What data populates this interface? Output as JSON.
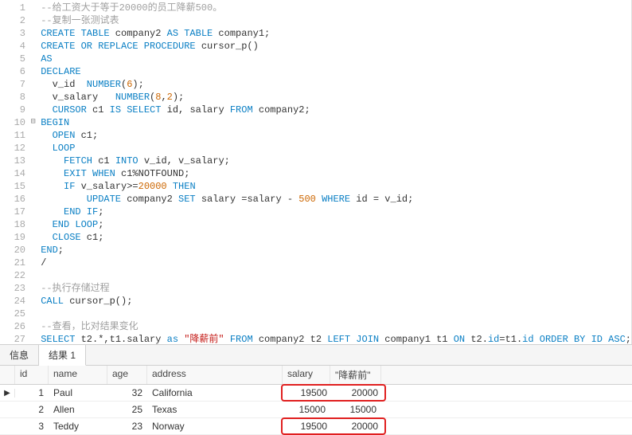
{
  "code": {
    "lines": [
      {
        "n": 1,
        "segs": [
          {
            "c": "cm",
            "t": "--给工资大于等于20000的员工降薪500。"
          }
        ]
      },
      {
        "n": 2,
        "segs": [
          {
            "c": "cm",
            "t": "--复制一张测试表"
          }
        ]
      },
      {
        "n": 3,
        "segs": [
          {
            "c": "kw",
            "t": "CREATE TABLE"
          },
          {
            "c": "fn",
            "t": " company2 "
          },
          {
            "c": "kw",
            "t": "AS TABLE"
          },
          {
            "c": "fn",
            "t": " company1;"
          }
        ]
      },
      {
        "n": 4,
        "segs": [
          {
            "c": "kw",
            "t": "CREATE OR REPLACE PROCEDURE"
          },
          {
            "c": "fn",
            "t": " cursor_p()"
          }
        ]
      },
      {
        "n": 5,
        "segs": [
          {
            "c": "kw",
            "t": "AS"
          }
        ]
      },
      {
        "n": 6,
        "segs": [
          {
            "c": "kw",
            "t": "DECLARE"
          }
        ]
      },
      {
        "n": 7,
        "segs": [
          {
            "c": "fn",
            "t": "  v_id  "
          },
          {
            "c": "kw",
            "t": "NUMBER"
          },
          {
            "c": "fn",
            "t": "("
          },
          {
            "c": "nm",
            "t": "6"
          },
          {
            "c": "fn",
            "t": ");"
          }
        ]
      },
      {
        "n": 8,
        "segs": [
          {
            "c": "fn",
            "t": "  v_salary   "
          },
          {
            "c": "kw",
            "t": "NUMBER"
          },
          {
            "c": "fn",
            "t": "("
          },
          {
            "c": "nm",
            "t": "8"
          },
          {
            "c": "fn",
            "t": ","
          },
          {
            "c": "nm",
            "t": "2"
          },
          {
            "c": "fn",
            "t": ");"
          }
        ]
      },
      {
        "n": 9,
        "segs": [
          {
            "c": "fn",
            "t": "  "
          },
          {
            "c": "kw",
            "t": "CURSOR"
          },
          {
            "c": "fn",
            "t": " c1 "
          },
          {
            "c": "kw",
            "t": "IS SELECT"
          },
          {
            "c": "fn",
            "t": " id, salary "
          },
          {
            "c": "kw",
            "t": "FROM"
          },
          {
            "c": "fn",
            "t": " company2;"
          }
        ]
      },
      {
        "n": 10,
        "fold": "⊟",
        "segs": [
          {
            "c": "kw",
            "t": "BEGIN"
          }
        ]
      },
      {
        "n": 11,
        "segs": [
          {
            "c": "fn",
            "t": "  "
          },
          {
            "c": "kw",
            "t": "OPEN"
          },
          {
            "c": "fn",
            "t": " c1;"
          }
        ]
      },
      {
        "n": 12,
        "segs": [
          {
            "c": "fn",
            "t": "  "
          },
          {
            "c": "kw",
            "t": "LOOP"
          }
        ]
      },
      {
        "n": 13,
        "segs": [
          {
            "c": "fn",
            "t": "    "
          },
          {
            "c": "kw",
            "t": "FETCH"
          },
          {
            "c": "fn",
            "t": " c1 "
          },
          {
            "c": "kw",
            "t": "INTO"
          },
          {
            "c": "fn",
            "t": " v_id, v_salary;"
          }
        ]
      },
      {
        "n": 14,
        "segs": [
          {
            "c": "fn",
            "t": "    "
          },
          {
            "c": "kw",
            "t": "EXIT WHEN"
          },
          {
            "c": "fn",
            "t": " c1%NOTFOUND;"
          }
        ]
      },
      {
        "n": 15,
        "segs": [
          {
            "c": "fn",
            "t": "    "
          },
          {
            "c": "kw",
            "t": "IF"
          },
          {
            "c": "fn",
            "t": " v_salary>="
          },
          {
            "c": "nm",
            "t": "20000"
          },
          {
            "c": "fn",
            "t": " "
          },
          {
            "c": "kw",
            "t": "THEN"
          }
        ]
      },
      {
        "n": 16,
        "segs": [
          {
            "c": "fn",
            "t": "        "
          },
          {
            "c": "kw",
            "t": "UPDATE"
          },
          {
            "c": "fn",
            "t": " company2 "
          },
          {
            "c": "kw",
            "t": "SET"
          },
          {
            "c": "fn",
            "t": " salary =salary - "
          },
          {
            "c": "nm",
            "t": "500"
          },
          {
            "c": "fn",
            "t": " "
          },
          {
            "c": "kw",
            "t": "WHERE"
          },
          {
            "c": "fn",
            "t": " id = v_id;"
          }
        ]
      },
      {
        "n": 17,
        "segs": [
          {
            "c": "fn",
            "t": "    "
          },
          {
            "c": "kw",
            "t": "END IF"
          },
          {
            "c": "fn",
            "t": ";"
          }
        ]
      },
      {
        "n": 18,
        "segs": [
          {
            "c": "fn",
            "t": "  "
          },
          {
            "c": "kw",
            "t": "END LOOP"
          },
          {
            "c": "fn",
            "t": ";"
          }
        ]
      },
      {
        "n": 19,
        "segs": [
          {
            "c": "fn",
            "t": "  "
          },
          {
            "c": "kw",
            "t": "CLOSE"
          },
          {
            "c": "fn",
            "t": " c1;"
          }
        ]
      },
      {
        "n": 20,
        "segs": [
          {
            "c": "kw",
            "t": "END"
          },
          {
            "c": "fn",
            "t": ";"
          }
        ]
      },
      {
        "n": 21,
        "segs": [
          {
            "c": "fn",
            "t": "/"
          }
        ]
      },
      {
        "n": 22,
        "segs": [
          {
            "c": "fn",
            "t": ""
          }
        ]
      },
      {
        "n": 23,
        "segs": [
          {
            "c": "cm",
            "t": "--执行存储过程"
          }
        ]
      },
      {
        "n": 24,
        "segs": [
          {
            "c": "kw",
            "t": "CALL"
          },
          {
            "c": "fn",
            "t": " cursor_p();"
          }
        ]
      },
      {
        "n": 25,
        "segs": [
          {
            "c": "fn",
            "t": ""
          }
        ]
      },
      {
        "n": 26,
        "segs": [
          {
            "c": "cm",
            "t": "--查看，比对结果变化"
          }
        ]
      },
      {
        "n": 27,
        "segs": [
          {
            "c": "kw",
            "t": "SELECT"
          },
          {
            "c": "fn",
            "t": " t2.*,t1.salary "
          },
          {
            "c": "kw",
            "t": "as"
          },
          {
            "c": "fn",
            "t": " "
          },
          {
            "c": "str",
            "t": "\"降薪前\""
          },
          {
            "c": "fn",
            "t": " "
          },
          {
            "c": "kw",
            "t": "FROM"
          },
          {
            "c": "fn",
            "t": " company2 t2 "
          },
          {
            "c": "kw",
            "t": "LEFT JOIN"
          },
          {
            "c": "fn",
            "t": " company1 t1 "
          },
          {
            "c": "kw",
            "t": "ON"
          },
          {
            "c": "fn",
            "t": " t2."
          },
          {
            "c": "kw",
            "t": "id"
          },
          {
            "c": "fn",
            "t": "=t1."
          },
          {
            "c": "kw",
            "t": "id"
          },
          {
            "c": "fn",
            "t": " "
          },
          {
            "c": "kw",
            "t": "ORDER BY ID ASC"
          },
          {
            "c": "fn",
            "t": ";"
          }
        ]
      }
    ]
  },
  "tabs": {
    "info": "信息",
    "result": "结果 1"
  },
  "grid": {
    "headers": {
      "id": "id",
      "name": "name",
      "age": "age",
      "address": "address",
      "salary": "salary",
      "before": "\"降薪前\""
    },
    "rows": [
      {
        "ptr": "▶",
        "id": "1",
        "name": "Paul",
        "age": "32",
        "address": "California",
        "salary": "19500",
        "before": "20000",
        "hl": true
      },
      {
        "ptr": "",
        "id": "2",
        "name": "Allen",
        "age": "25",
        "address": "Texas",
        "salary": "15000",
        "before": "15000",
        "hl": false
      },
      {
        "ptr": "",
        "id": "3",
        "name": "Teddy",
        "age": "23",
        "address": "Norway",
        "salary": "19500",
        "before": "20000",
        "hl": true
      }
    ]
  }
}
